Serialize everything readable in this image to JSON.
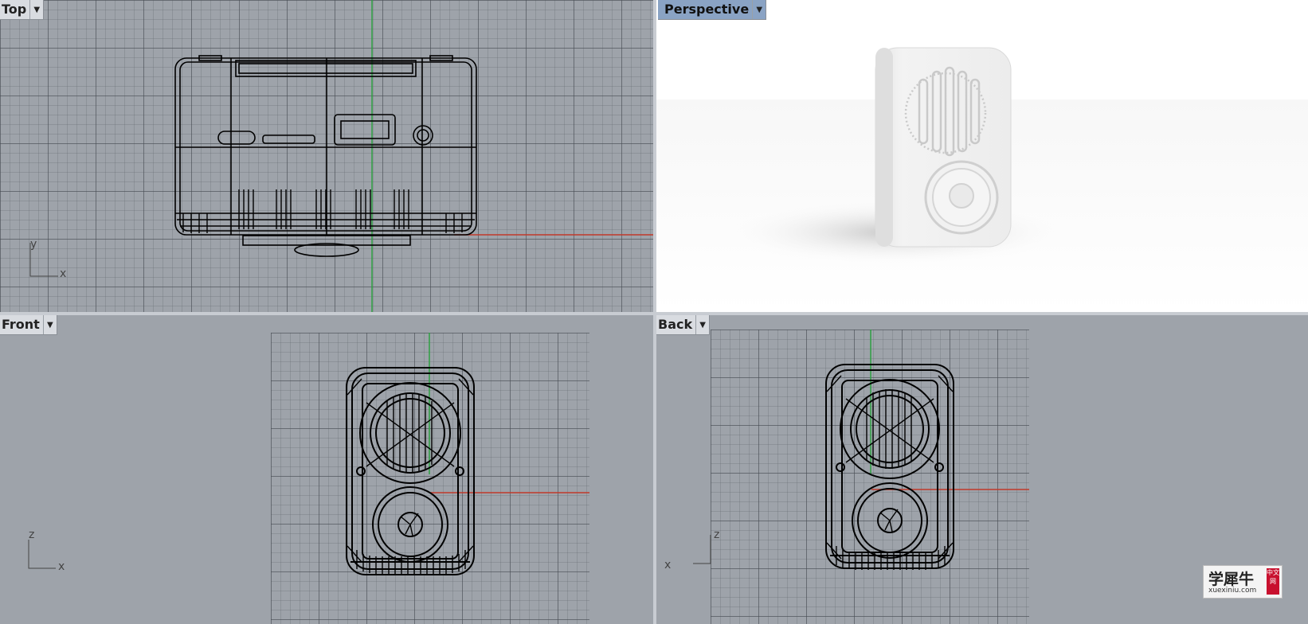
{
  "viewports": {
    "top": {
      "label": "Top",
      "axis": {
        "a": "y",
        "b": "x"
      }
    },
    "perspective": {
      "label": "Perspective"
    },
    "front": {
      "label": "Front",
      "axis": {
        "a": "z",
        "b": "x"
      }
    },
    "back": {
      "label": "Back",
      "axis": {
        "a": "z",
        "b": "x"
      }
    }
  },
  "watermark": {
    "text_cn": "学犀牛",
    "text_en": "xuexiniu.com",
    "badge": "中文网"
  },
  "colors": {
    "grid_bg": "#9ea3aa",
    "label_active": "#8aa3c4",
    "x_axis": "#c0392b",
    "y_axis": "#2ea043"
  }
}
